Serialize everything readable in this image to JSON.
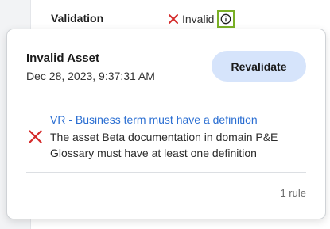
{
  "validation": {
    "label": "Validation",
    "status_text": "Invalid",
    "status_icon": "x-icon",
    "info_icon": "info-icon"
  },
  "popover": {
    "title": "Invalid Asset",
    "timestamp": "Dec 28, 2023, 9:37:31 AM",
    "revalidate_label": "Revalidate",
    "rules": [
      {
        "name": "VR - Business term must have a definition",
        "description": "The asset Beta documentation in domain P&E Glossary must have at least one definition",
        "status_icon": "x-icon"
      }
    ],
    "rule_count": "1 rule"
  },
  "colors": {
    "error": "#d42a2a",
    "link": "#2a6ed2",
    "button_bg": "#d6e4fb",
    "focus_outline": "#7ab026"
  }
}
